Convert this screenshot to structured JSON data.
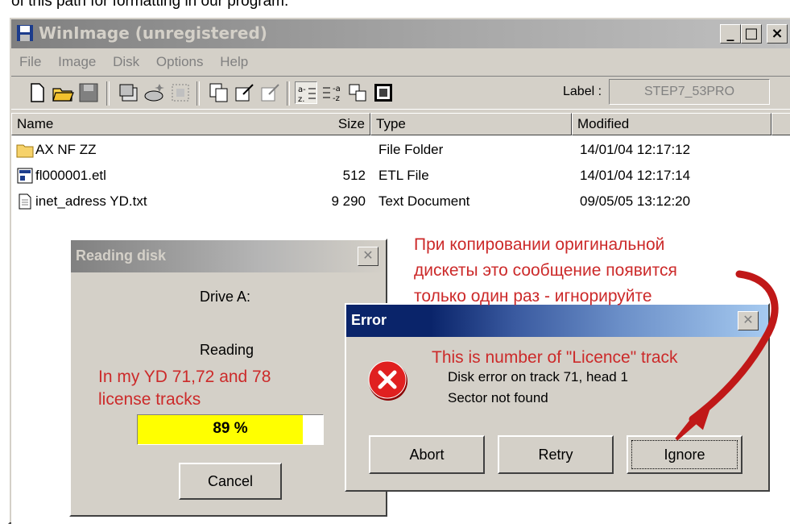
{
  "caption": {
    "text": "of this path for formatting in our program."
  },
  "window": {
    "title": "WinImage (unregistered)",
    "min": "_",
    "max": "□",
    "close": "×"
  },
  "menu": [
    "File",
    "Image",
    "Disk",
    "Options",
    "Help"
  ],
  "toolbar": {
    "label_caption": "Label :",
    "label_value": "STEP7_53PRO"
  },
  "columns": {
    "name": "Name",
    "size": "Size",
    "type": "Type",
    "modified": "Modified"
  },
  "files": [
    {
      "name": "AX NF ZZ",
      "size": "",
      "type": "File Folder",
      "modified": "14/01/04  12:17:12",
      "icon": "folder-icon"
    },
    {
      "name": "fl000001.etl",
      "size": "512",
      "type": "ETL File",
      "modified": "14/01/04  12:17:14",
      "icon": "etl-file-icon"
    },
    {
      "name": "inet_adress YD.txt",
      "size": "9 290",
      "type": "Text Document",
      "modified": "09/05/05  13:12:20",
      "icon": "text-file-icon"
    }
  ],
  "reading_dialog": {
    "title": "Reading disk",
    "drive": "Drive A:",
    "status": "Reading",
    "progress_label": "89 %",
    "progress_value": 0.89,
    "cancel": "Cancel"
  },
  "error_dialog": {
    "title": "Error",
    "message_line1": "Disk error on track 71, head 1",
    "message_line2": "Sector not found",
    "abort": "Abort",
    "retry": "Retry",
    "ignore": "Ignore"
  },
  "annotations": {
    "ru_line1": "При копировании оригинальной",
    "ru_line2": "дискеты это сообщение появится",
    "ru_line3": "только один раз - игнорируйте",
    "licence_note": "This is number of \"Licence\" track",
    "yd_line1": "In my YD 71,72 and 78",
    "yd_line2": "license tracks",
    "color": "#cc2a2a"
  }
}
